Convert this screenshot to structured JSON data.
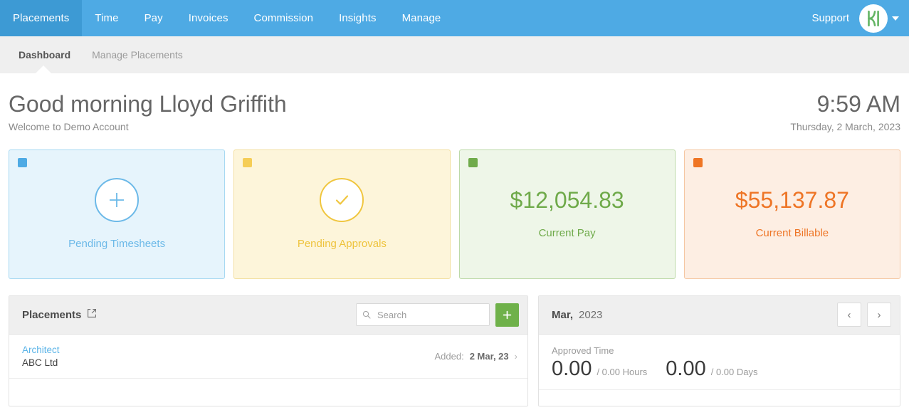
{
  "topnav": {
    "items": [
      {
        "label": "Placements",
        "active": true
      },
      {
        "label": "Time",
        "active": false
      },
      {
        "label": "Pay",
        "active": false
      },
      {
        "label": "Invoices",
        "active": false
      },
      {
        "label": "Commission",
        "active": false
      },
      {
        "label": "Insights",
        "active": false
      },
      {
        "label": "Manage",
        "active": false
      }
    ],
    "support_label": "Support",
    "logo_letter": "K",
    "logo_color": "#63b463",
    "bar_color": "#4eaae4",
    "active_tab_color": "#3d9ad4"
  },
  "subnav": {
    "items": [
      {
        "label": "Dashboard",
        "active": true
      },
      {
        "label": "Manage Placements",
        "active": false
      }
    ]
  },
  "greeting": {
    "title": "Good morning Lloyd Griffith",
    "subtitle": "Welcome to Demo Account",
    "time": "9:59 AM",
    "date": "Thursday, 2 March, 2023"
  },
  "cards": [
    {
      "label": "Pending Timesheets",
      "value": "",
      "icon": "plus-icon",
      "color": "#6cb9e8",
      "style": "blue"
    },
    {
      "label": "Pending Approvals",
      "value": "",
      "icon": "check-icon",
      "color": "#eec33c",
      "style": "yellow"
    },
    {
      "label": "Current Pay",
      "value": "$12,054.83",
      "icon": "",
      "color": "#6faa4a",
      "style": "green"
    },
    {
      "label": "Current Billable",
      "value": "$55,137.87",
      "icon": "",
      "color": "#ee7526",
      "style": "orange"
    }
  ],
  "placements_panel": {
    "title": "Placements",
    "external_link_icon": "external-link-icon",
    "search_placeholder": "Search",
    "search_value": "",
    "add_button_label": "+",
    "rows": [
      {
        "role": "Architect",
        "company": "ABC Ltd",
        "meta_prefix": "Added:",
        "meta_value": "2 Mar, 23"
      }
    ]
  },
  "approved_panel": {
    "month": "Mar,",
    "year": "2023",
    "prev_label": "‹",
    "next_label": "›",
    "section_title": "Approved Time",
    "metrics": [
      {
        "value": "0.00",
        "suffix": "/ 0.00 Hours"
      },
      {
        "value": "0.00",
        "suffix": "/ 0.00 Days"
      }
    ]
  }
}
